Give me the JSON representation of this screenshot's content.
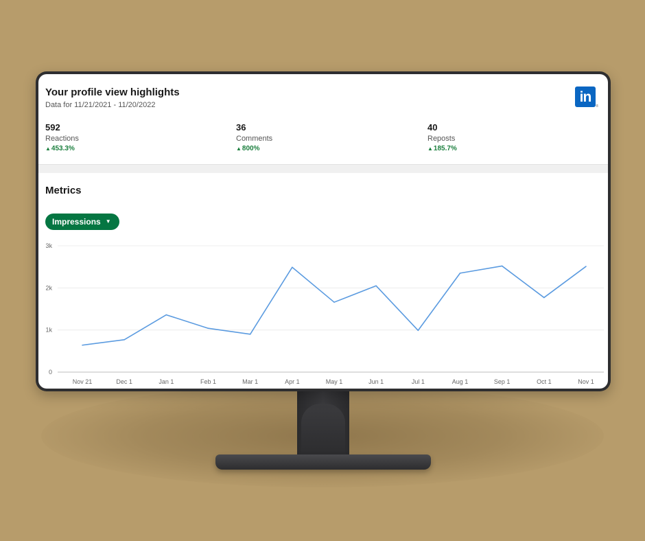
{
  "header": {
    "title": "Your profile view highlights",
    "subtitle": "Data for 11/21/2021 - 11/20/2022",
    "logo_text": "in",
    "logo_mark": "®"
  },
  "stats": [
    {
      "value": "592",
      "label": "Reactions",
      "change": "453.3%"
    },
    {
      "value": "36",
      "label": "Comments",
      "change": "800%"
    },
    {
      "value": "40",
      "label": "Reposts",
      "change": "185.7%"
    }
  ],
  "metrics": {
    "title": "Metrics",
    "dropdown_label": "Impressions",
    "dropdown_caret": "▼"
  },
  "colors": {
    "accent": "#0a66c2",
    "positive": "#1b7f3e",
    "pill": "#057642",
    "line": "#5b9be0"
  },
  "chart_data": {
    "type": "line",
    "categories": [
      "Nov 21",
      "Dec 1",
      "Jan 1",
      "Feb 1",
      "Mar 1",
      "Apr 1",
      "May 1",
      "Jun 1",
      "Jul 1",
      "Aug 1",
      "Sep 1",
      "Oct 1",
      "Nov 1"
    ],
    "values": [
      640,
      770,
      1360,
      1040,
      900,
      2490,
      1660,
      2050,
      990,
      2350,
      2520,
      1770,
      2510
    ],
    "yticks": [
      0,
      1000,
      2000,
      3000
    ],
    "ytick_labels": [
      "0",
      "1k",
      "2k",
      "3k"
    ],
    "ylim": [
      0,
      3000
    ],
    "grid": true
  }
}
